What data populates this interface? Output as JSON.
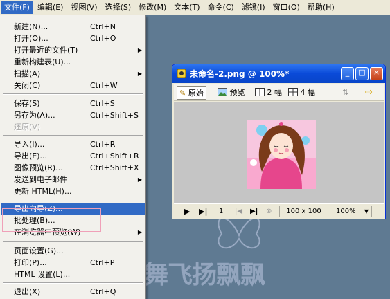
{
  "menubar": {
    "items": [
      {
        "label": "文件(F)"
      },
      {
        "label": "编辑(E)"
      },
      {
        "label": "视图(V)"
      },
      {
        "label": "选择(S)"
      },
      {
        "label": "修改(M)"
      },
      {
        "label": "文本(T)"
      },
      {
        "label": "命令(C)"
      },
      {
        "label": "滤镜(I)"
      },
      {
        "label": "窗口(O)"
      },
      {
        "label": "帮助(H)"
      }
    ]
  },
  "file_menu": {
    "items": [
      {
        "label": "新建(N)...",
        "shortcut": "Ctrl+N"
      },
      {
        "label": "打开(O)...",
        "shortcut": "Ctrl+O"
      },
      {
        "label": "打开最近的文件(T)",
        "shortcut": ""
      },
      {
        "label": "重新构建表(U)...",
        "shortcut": ""
      },
      {
        "label": "扫描(A)",
        "shortcut": ""
      },
      {
        "label": "关闭(C)",
        "shortcut": "Ctrl+W"
      },
      {
        "label": "保存(S)",
        "shortcut": "Ctrl+S"
      },
      {
        "label": "另存为(A)...",
        "shortcut": "Ctrl+Shift+S"
      },
      {
        "label": "还原(V)",
        "shortcut": ""
      },
      {
        "label": "导入(I)...",
        "shortcut": "Ctrl+R"
      },
      {
        "label": "导出(E)...",
        "shortcut": "Ctrl+Shift+R"
      },
      {
        "label": "图像预览(R)...",
        "shortcut": "Ctrl+Shift+X"
      },
      {
        "label": "发送到电子邮件",
        "shortcut": ""
      },
      {
        "label": "更新 HTML(H)...",
        "shortcut": ""
      },
      {
        "label": "导出向导(Z)...",
        "shortcut": ""
      },
      {
        "label": "批处理(B)...",
        "shortcut": ""
      },
      {
        "label": "在浏览器中预览(W)",
        "shortcut": ""
      },
      {
        "label": "页面设置(G)...",
        "shortcut": ""
      },
      {
        "label": "打印(P)...",
        "shortcut": "Ctrl+P"
      },
      {
        "label": "HTML 设置(L)...",
        "shortcut": ""
      },
      {
        "label": "退出(X)",
        "shortcut": "Ctrl+Q"
      }
    ]
  },
  "doc_window": {
    "title": "未命名-2.png @ 100%*",
    "min_label": "_",
    "max_label": "□",
    "close_label": "×",
    "tabs": {
      "original": "原始",
      "preview": "预览",
      "two_up": "2 幅",
      "four_up": "4 幅"
    },
    "status": {
      "frame": "1",
      "size": "100 x 100",
      "zoom": "100%"
    }
  },
  "watermark": "轻舞飞扬飘飘",
  "colors": {
    "menu_highlight": "#316ac5",
    "titlebar": "#0a4ad8",
    "workspace": "#5f7a92",
    "artwork_pink": "#e6468c"
  }
}
